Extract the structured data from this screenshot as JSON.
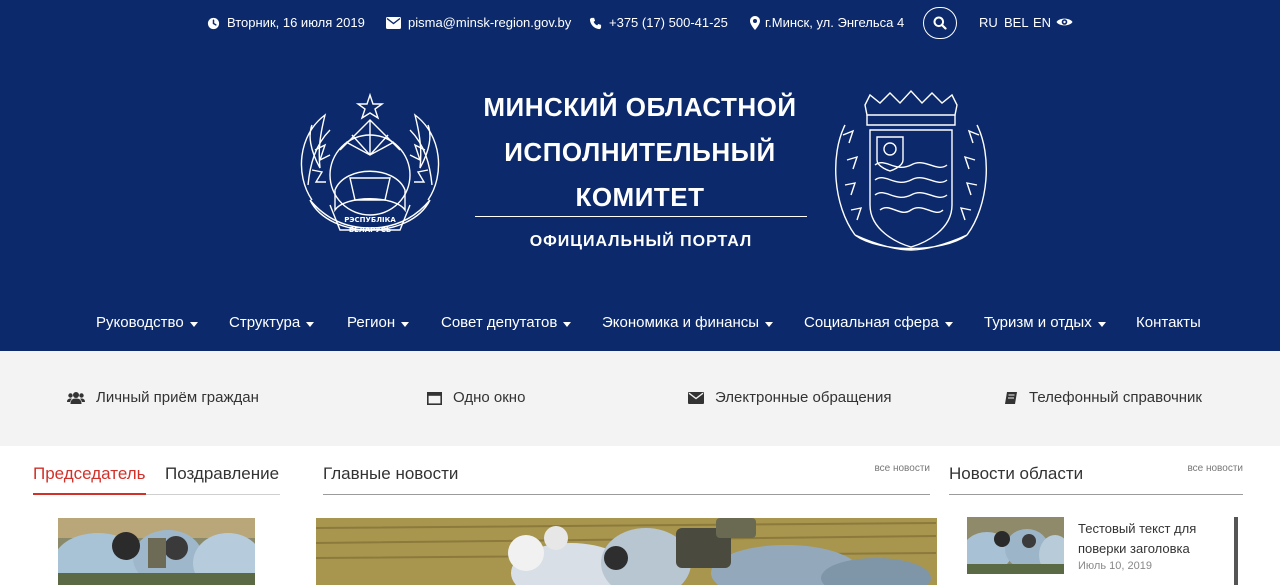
{
  "topbar": {
    "date": "Вторник, 16 июля 2019",
    "email": "pisma@minsk-region.gov.by",
    "phone": "+375 (17) 500-41-25",
    "address": "г.Минск, ул. Энгельса 4",
    "languages": [
      "RU",
      "BEL",
      "EN"
    ]
  },
  "header": {
    "title_lines": [
      "МИНСКИЙ ОБЛАСТНОЙ",
      "ИСПОЛНИТЕЛЬНЫЙ",
      "КОМИТЕТ"
    ],
    "subtitle": "ОФИЦИАЛЬНЫЙ ПОРТАЛ",
    "emblem_left_text": [
      "РЭСПУБЛІКА",
      "БЕЛАРУСЬ"
    ]
  },
  "nav": {
    "items": [
      {
        "label": "Руководство",
        "dropdown": true
      },
      {
        "label": "Структура",
        "dropdown": true
      },
      {
        "label": "Регион",
        "dropdown": true
      },
      {
        "label": "Совет депутатов",
        "dropdown": true
      },
      {
        "label": "Экономика и финансы",
        "dropdown": true
      },
      {
        "label": "Социальная сфера",
        "dropdown": true
      },
      {
        "label": "Туризм и отдых",
        "dropdown": true
      },
      {
        "label": "Контакты",
        "dropdown": false
      }
    ]
  },
  "quick_links": [
    {
      "label": "Личный приём граждан",
      "icon": "users-icon"
    },
    {
      "label": "Одно окно",
      "icon": "window-icon"
    },
    {
      "label": "Электронные обращения",
      "icon": "envelope-icon"
    },
    {
      "label": "Телефонный справочник",
      "icon": "book-icon"
    }
  ],
  "left_tabs": {
    "items": [
      "Председатель",
      "Поздравление"
    ],
    "active_index": 0
  },
  "main_news": {
    "title": "Главные новости",
    "all_link": "все новости"
  },
  "region_news": {
    "title": "Новости области",
    "all_link": "все новости",
    "items": [
      {
        "title": "Тестовый текст для поверки заголовка",
        "date": "Июль 10, 2019"
      }
    ]
  },
  "colors": {
    "header_bg": "#0c2a6b",
    "accent_red": "#d2312a",
    "quick_bg": "#f3f3f3"
  }
}
